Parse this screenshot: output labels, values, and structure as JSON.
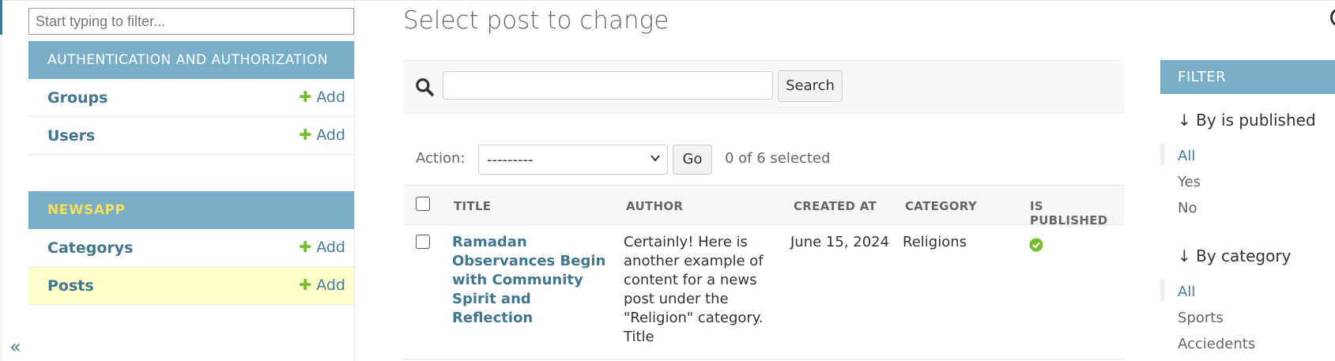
{
  "sidebar": {
    "filter_placeholder": "Start typing to filter...",
    "apps": [
      {
        "name": "AUTHENTICATION AND AUTHORIZATION",
        "models": [
          {
            "label": "Groups",
            "add_label": "Add"
          },
          {
            "label": "Users",
            "add_label": "Add"
          }
        ]
      },
      {
        "name": "NEWSAPP",
        "models": [
          {
            "label": "Categorys",
            "add_label": "Add"
          },
          {
            "label": "Posts",
            "add_label": "Add",
            "current": true
          }
        ]
      }
    ],
    "collapse_glyph": "«",
    "icon_names": {
      "add": "plus-icon",
      "collapse": "double-chevron-left-icon"
    }
  },
  "main": {
    "title": "Select post to change",
    "search": {
      "value": "",
      "button_label": "Search",
      "icon": "search-icon"
    },
    "actions": {
      "label": "Action:",
      "selected_option": "---------",
      "go_label": "Go",
      "counter": "0 of 6 selected"
    },
    "table": {
      "columns": [
        "TITLE",
        "AUTHOR",
        "CREATED AT",
        "CATEGORY",
        "IS PUBLISHED"
      ],
      "rows": [
        {
          "title_lines": [
            "Ramadan",
            "Observances Begin",
            "with Community",
            "Spirit and Reflection"
          ],
          "author_lines": [
            "Certainly! Here is",
            "another example of",
            "content for a news",
            "post under the",
            "\"Religion\" category.",
            "Title"
          ],
          "created_at": "June 15, 2024",
          "category": "Religions",
          "is_published": true
        }
      ]
    }
  },
  "filter": {
    "header": "FILTER",
    "groups": [
      {
        "heading": "↓ By is published",
        "options": [
          "All",
          "Yes",
          "No"
        ],
        "selected": "All"
      },
      {
        "heading": "↓ By category",
        "options": [
          "All",
          "Sports",
          "Acciedents"
        ],
        "selected": "All"
      }
    ]
  },
  "colors": {
    "module_header": "#79aec8",
    "link": "#417690",
    "add_plus": "#70bf2b",
    "current_row": "#ffffcc",
    "newsapp_header_text": "#f5dd5d",
    "published_icon": "#70bf2b"
  }
}
